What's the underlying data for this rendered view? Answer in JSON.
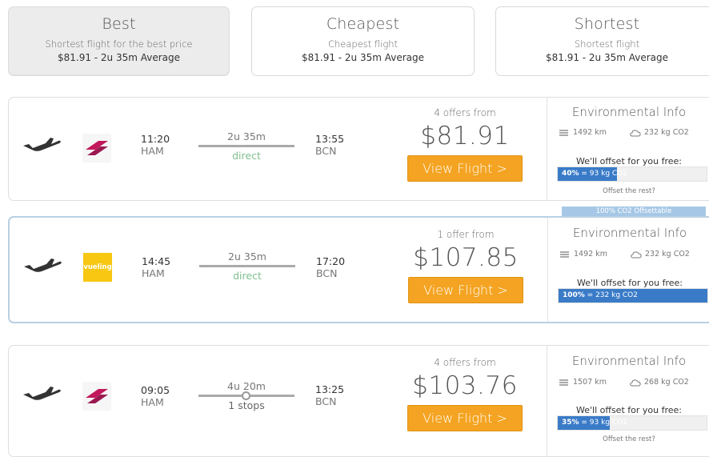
{
  "tabs": [
    {
      "title": "Best",
      "desc": "Shortest flight for the best price",
      "summary": "$81.91 - 2u 35m Average"
    },
    {
      "title": "Cheapest",
      "desc": "Cheapest flight",
      "summary": "$81.91 - 2u 35m Average"
    },
    {
      "title": "Shortest",
      "desc": "Shortest flight",
      "summary": "$81.91 - 2u 35m Average"
    }
  ],
  "icons": {
    "plane": "plane-takeoff-icon",
    "distance": "route-icon",
    "co2": "cloud-icon",
    "stop": "stop-dot-icon"
  },
  "colors": {
    "button": "#f4a422",
    "offset_bar": "#3a7bc8",
    "direct": "#7fbf8f",
    "selected_border": "#b9d0e3",
    "badge": "#a6c8e6"
  },
  "flights": [
    {
      "airline": "Eurowings",
      "logo_text": "",
      "dep_time": "11:20",
      "dep_code": "HAM",
      "duration": "2u 35m",
      "stops_text": "direct",
      "arr_time": "13:55",
      "arr_code": "BCN",
      "offers": "4 offers from",
      "price": "$81.91",
      "button": "View Flight >",
      "env_title": "Environmental Info",
      "distance": "1492 km",
      "co2": "232 kg CO2",
      "offset_text": "We'll offset for you free:",
      "offset_pct": "40%",
      "offset_amount": " = 93 kg CO2",
      "offset_fraction": 0.4,
      "rest": "Offset the rest?"
    },
    {
      "airline": "Vueling",
      "logo_text": "vueling",
      "dep_time": "14:45",
      "dep_code": "HAM",
      "duration": "2u 35m",
      "stops_text": "direct",
      "arr_time": "17:20",
      "arr_code": "BCN",
      "offers": "1 offer from",
      "price": "$107.85",
      "button": "View Flight >",
      "badge": "100% CO2 Offsettable",
      "env_title": "Environmental Info",
      "distance": "1492 km",
      "co2": "232 kg CO2",
      "offset_text": "We'll offset for you free:",
      "offset_pct": "100%",
      "offset_amount": " = 232 kg CO2",
      "offset_fraction": 1.0
    },
    {
      "airline": "Eurowings",
      "logo_text": "",
      "dep_time": "09:05",
      "dep_code": "HAM",
      "duration": "4u 20m",
      "stops_text": "1 stops",
      "arr_time": "13:25",
      "arr_code": "BCN",
      "offers": "4 offers from",
      "price": "$103.76",
      "button": "View Flight >",
      "env_title": "Environmental Info",
      "distance": "1507 km",
      "co2": "268 kg CO2",
      "offset_text": "We'll offset for you free:",
      "offset_pct": "35%",
      "offset_amount": " = 93 kg CO2",
      "offset_fraction": 0.35,
      "rest": "Offset the rest?"
    }
  ]
}
